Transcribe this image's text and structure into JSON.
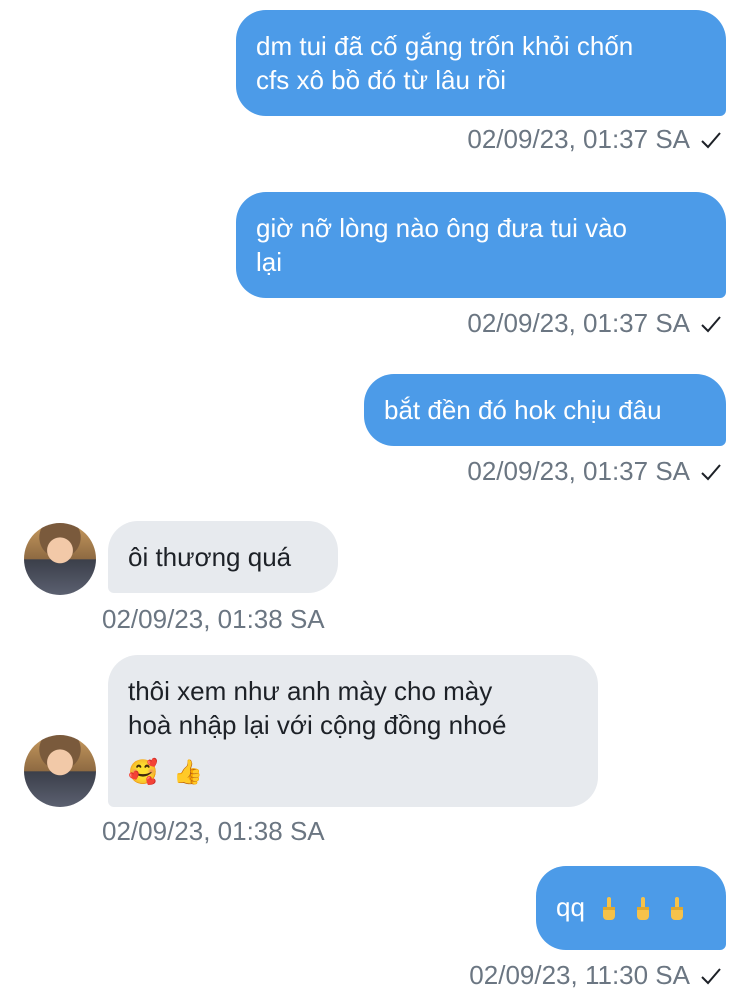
{
  "messages": [
    {
      "text_line1": "dm tui đã cố gắng trốn khỏi chốn",
      "text_line2": "cfs xô bồ đó từ lâu rồi",
      "time": "02/09/23, 01:37 SA"
    },
    {
      "text_line1": "giờ nỡ lòng nào ông đưa tui vào",
      "text_line2": "lại",
      "time": "02/09/23, 01:37 SA"
    },
    {
      "text": "bắt đền đó hok chịu đâu",
      "time": "02/09/23, 01:37 SA"
    },
    {
      "text": "ôi thương quá",
      "time": "02/09/23, 01:38 SA"
    },
    {
      "text_line1": "thôi xem như anh mày cho mày",
      "text_line2": "hoà nhập lại với cộng đồng nhoé",
      "emojis": [
        "smiling-face-with-hearts",
        "thumbs-up"
      ],
      "emoji_chars": [
        "🥰",
        "👍"
      ],
      "time": "02/09/23, 01:38 SA"
    },
    {
      "text": "qq",
      "emojis": [
        "middle-finger",
        "middle-finger",
        "middle-finger"
      ],
      "time": "02/09/23, 11:30 SA"
    }
  ],
  "colors": {
    "outgoing_bubble": "#4c9be8",
    "incoming_bubble": "#e7eaee",
    "timestamp": "#6b7682"
  }
}
